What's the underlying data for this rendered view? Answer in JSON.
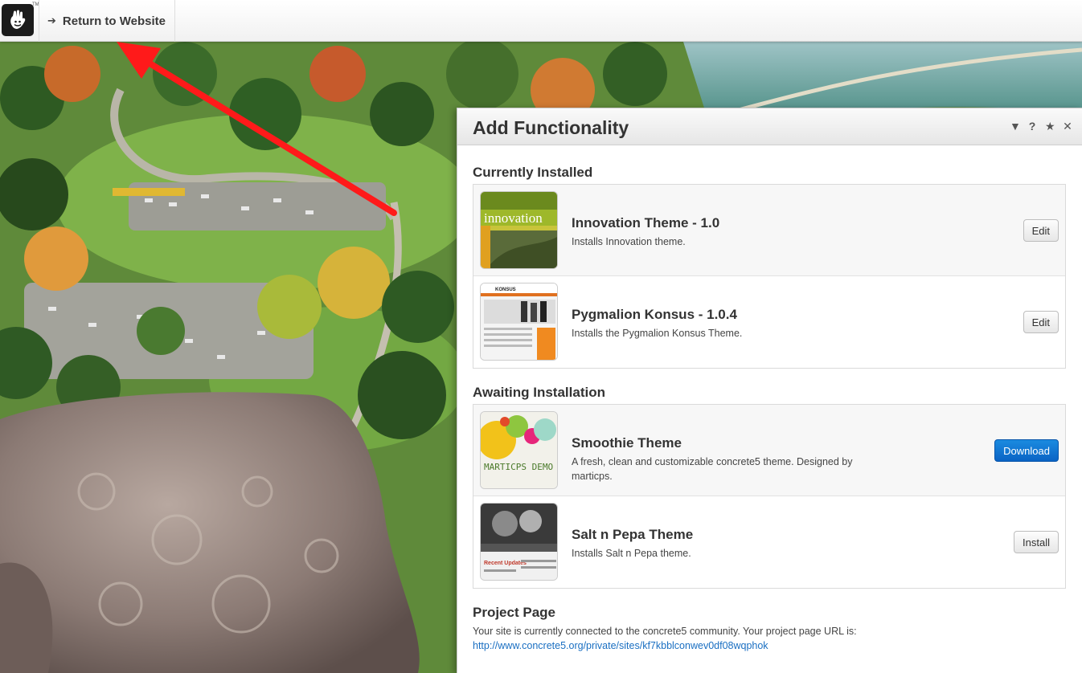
{
  "toolbar": {
    "logo_icon": "concrete5-hand-logo-icon",
    "return_label": "Return to Website",
    "return_icon": "arrow-left-icon"
  },
  "panel": {
    "title": "Add Functionality",
    "header_icons": [
      "dropdown-icon",
      "help-icon",
      "favorite-star-icon",
      "close-icon"
    ],
    "installed": {
      "title": "Currently Installed",
      "items": [
        {
          "name": "Innovation Theme - 1.0",
          "desc": "Installs Innovation theme.",
          "button": "Edit",
          "thumb_text": "innovation"
        },
        {
          "name": "Pygmalion Konsus - 1.0.4",
          "desc": "Installs the Pygmalion Konsus Theme.",
          "button": "Edit",
          "thumb_text": "KONSUS"
        }
      ]
    },
    "awaiting": {
      "title": "Awaiting Installation",
      "items": [
        {
          "name": "Smoothie Theme",
          "desc": "A fresh, clean and customizable concrete5 theme. Designed by marticps.",
          "button": "Download",
          "thumb_text": "MARTICPS DEMO"
        },
        {
          "name": "Salt n Pepa Theme",
          "desc": "Installs Salt n Pepa theme.",
          "button": "Install",
          "thumb_text": "Recent Updates"
        }
      ]
    },
    "project": {
      "title": "Project Page",
      "text": "Your site is currently connected to the concrete5 community. Your project page URL is:",
      "url": "http://www.concrete5.org/private/sites/kf7kbblconwev0df08wqphok"
    }
  },
  "colors": {
    "accent_blue": "#0a63c4",
    "annotation_red": "#ff1a1a",
    "link": "#1a6fc2"
  }
}
